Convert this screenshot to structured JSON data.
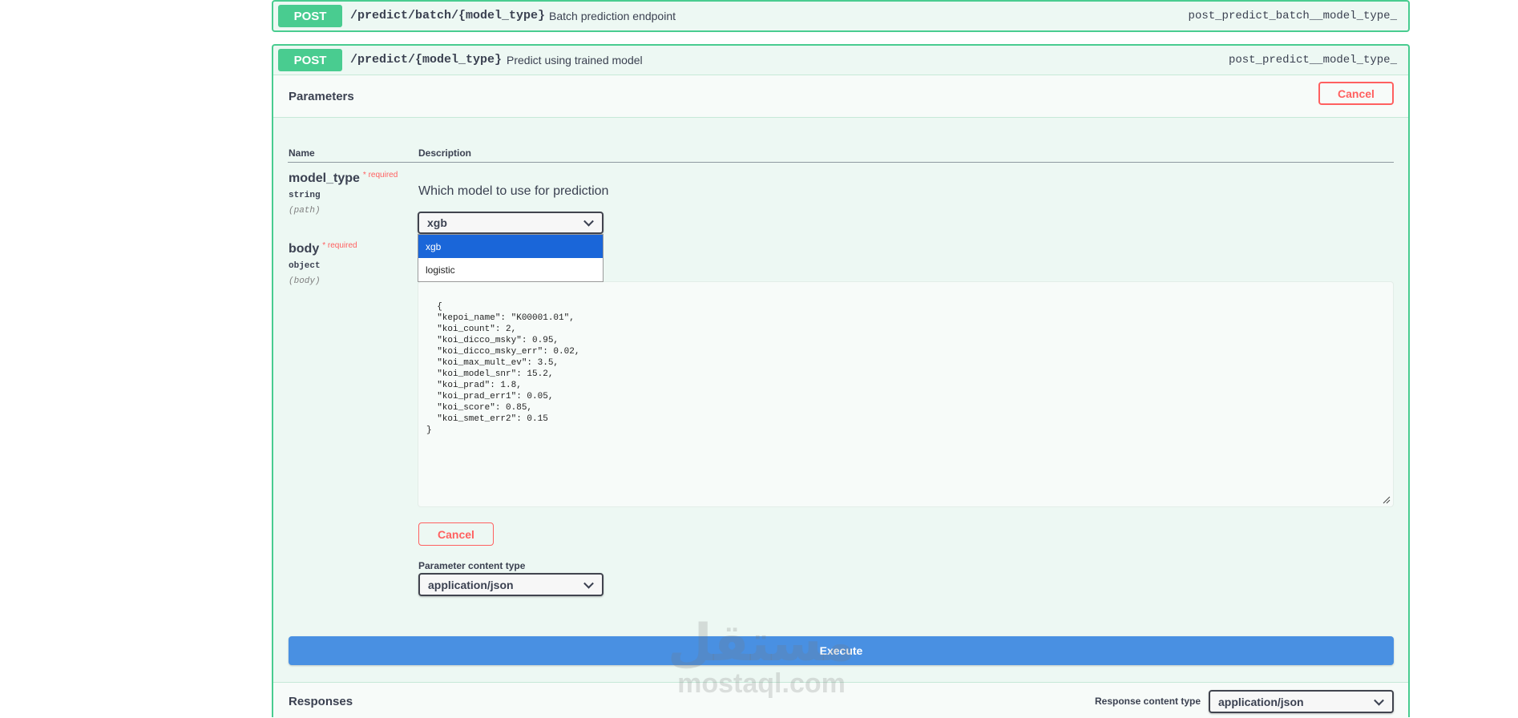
{
  "op1": {
    "method": "POST",
    "path": "/predict/batch/{model_type}",
    "summary": "Batch prediction endpoint",
    "operation_id": "post_predict_batch__model_type_"
  },
  "op2": {
    "method": "POST",
    "path": "/predict/{model_type}",
    "summary": "Predict using trained model",
    "operation_id": "post_predict__model_type_",
    "parameters_title": "Parameters",
    "cancel_label": "Cancel",
    "columns": {
      "name": "Name",
      "description": "Description"
    },
    "params": [
      {
        "name": "model_type",
        "required": "* required",
        "type": "string",
        "in": "(path)",
        "description": "Which model to use for prediction",
        "selected": "xgb",
        "options": [
          "xgb",
          "logistic"
        ]
      },
      {
        "name": "body",
        "required": "* required",
        "type": "object",
        "in": "(body)",
        "value": "{\n  \"kepoi_name\": \"K00001.01\",\n  \"koi_count\": 2,\n  \"koi_dicco_msky\": 0.95,\n  \"koi_dicco_msky_err\": 0.02,\n  \"koi_max_mult_ev\": 3.5,\n  \"koi_model_snr\": 15.2,\n  \"koi_prad\": 1.8,\n  \"koi_prad_err1\": 0.05,\n  \"koi_score\": 0.85,\n  \"koi_smet_err2\": 0.15\n}"
      }
    ],
    "body_cancel_label": "Cancel",
    "content_type_label": "Parameter content type",
    "content_type_value": "application/json",
    "execute_label": "Execute",
    "responses_title": "Responses",
    "response_content_type_label": "Response content type",
    "response_content_type_value": "application/json"
  },
  "watermark": {
    "arabic": "مستقل",
    "latin": "mostaql.com"
  },
  "colors": {
    "post": "#49cc90",
    "execute": "#4990e2",
    "cancel": "#ff6060",
    "selected_option": "#1a66d9"
  }
}
